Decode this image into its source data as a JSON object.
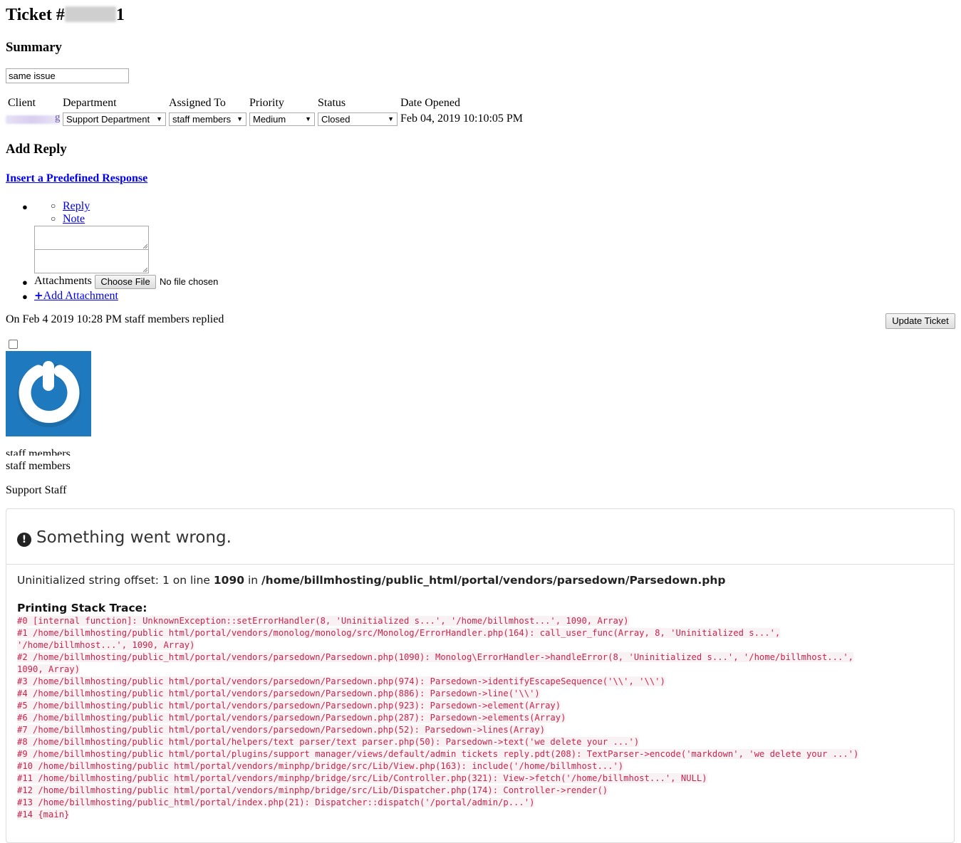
{
  "ticket": {
    "title_prefix": "Ticket #",
    "title_suffix": "1"
  },
  "summary": {
    "heading": "Summary",
    "value": "same issue"
  },
  "details": {
    "labels": {
      "client": "Client",
      "department": "Department",
      "assigned_to": "Assigned To",
      "priority": "Priority",
      "status": "Status",
      "date_opened": "Date Opened"
    },
    "client_suffix": "g",
    "department": "Support Department",
    "assigned_to": "staff members",
    "priority": "Medium",
    "status": "Closed",
    "date_opened": "Feb 04, 2019 10:10:05 PM"
  },
  "reply": {
    "heading": "Add Reply",
    "predefined_link": "Insert a Predefined Response",
    "tabs": [
      "Reply",
      "Note"
    ],
    "attachments_label": "Attachments",
    "choose_file": "Choose File",
    "no_file": "No file chosen",
    "add_attachment": "Add Attachment",
    "update_button": "Update Ticket"
  },
  "reply_entry": {
    "header": "On Feb 4 2019 10:28 PM staff members replied",
    "name_cut": "staff members",
    "name": "staff members",
    "role": "Support Staff"
  },
  "error": {
    "title": "Something went wrong.",
    "message_prefix": "Uninitialized string offset: 1 on line ",
    "line": "1090",
    "message_mid": " in ",
    "file": "/home/billmhosting/public_html/portal/vendors/parsedown/Parsedown.php",
    "trace_heading": "Printing Stack Trace:",
    "trace": [
      "#0 [internal function]: UnknownException::setErrorHandler(8, 'Uninitialized s...', '/home/billmhost...', 1090, Array)",
      "#1 /home/billmhosting/public html/portal/vendors/monolog/monolog/src/Monolog/ErrorHandler.php(164): call_user_func(Array, 8, 'Uninitialized s...',",
      "'/home/billmhost...', 1090, Array)",
      "#2 /home/billmhosting/public_html/portal/vendors/parsedown/Parsedown.php(1090): Monolog\\ErrorHandler->handleError(8, 'Uninitialized s...', '/home/billmhost...',",
      "1090, Array)",
      "#3 /home/billmhosting/public html/portal/vendors/parsedown/Parsedown.php(974): Parsedown->identifyEscapeSequence('\\\\', '\\\\')",
      "#4 /home/billmhosting/public html/portal/vendors/parsedown/Parsedown.php(886): Parsedown->line('\\\\')",
      "#5 /home/billmhosting/public html/portal/vendors/parsedown/Parsedown.php(923): Parsedown->element(Array)",
      "#6 /home/billmhosting/public html/portal/vendors/parsedown/Parsedown.php(287): Parsedown->elements(Array)",
      "#7 /home/billmhosting/public html/portal/vendors/parsedown/Parsedown.php(52): Parsedown->lines(Array)",
      "#8 /home/billmhosting/public html/portal/helpers/text parser/text parser.php(50): Parsedown->text('we delete your ...')",
      "#9 /home/billmhosting/public html/portal/plugins/support manager/views/default/admin tickets reply.pdt(208): TextParser->encode('markdown', 'we delete your ...')",
      "#10 /home/billmhosting/public html/portal/vendors/minphp/bridge/src/Lib/View.php(163): include('/home/billmhost...')",
      "#11 /home/billmhosting/public html/portal/vendors/minphp/bridge/src/Lib/Controller.php(321): View->fetch('/home/billmhost...', NULL)",
      "#12 /home/billmhosting/public html/portal/vendors/minphp/bridge/src/Lib/Dispatcher.php(174): Controller->render()",
      "#13 /home/billmhosting/public_html/portal/index.php(21): Dispatcher::dispatch('/portal/admin/p...')",
      "#14 {main}"
    ]
  }
}
